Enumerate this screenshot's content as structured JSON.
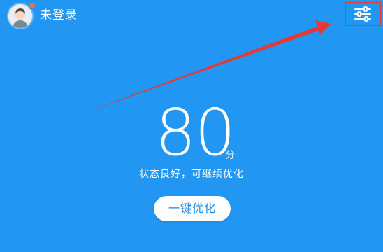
{
  "header": {
    "avatar_icon": "user-avatar-icon",
    "notification_dot_color": "#ff6b3d",
    "login_status": "未登录",
    "settings_icon": "sliders-settings-icon"
  },
  "score": {
    "value": "80",
    "unit": "分",
    "status": "状态良好，可继续优化"
  },
  "actions": {
    "optimize_label": "一键优化"
  },
  "annotation": {
    "highlight_color": "#e53935",
    "arrow_color": "#e53935"
  },
  "theme": {
    "background": "#2196f3",
    "button_text": "#1e88e5"
  }
}
